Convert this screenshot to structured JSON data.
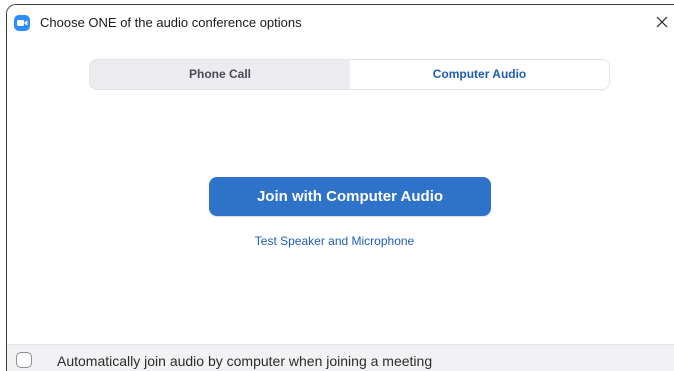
{
  "window": {
    "title": "Choose ONE of the audio conference options",
    "app_icon": "zoom-camera-icon",
    "close_icon": "close-icon"
  },
  "tabs": [
    {
      "label": "Phone Call",
      "selected": false
    },
    {
      "label": "Computer Audio",
      "selected": true
    }
  ],
  "main": {
    "join_button_label": "Join with Computer Audio",
    "test_link_label": "Test Speaker and Microphone"
  },
  "footer": {
    "checkbox_checked": false,
    "checkbox_label": "Automatically join audio by computer when joining a meeting"
  },
  "colors": {
    "accent": "#2f72c9",
    "link": "#1f5cb8",
    "app_icon": "#2d8cff"
  }
}
